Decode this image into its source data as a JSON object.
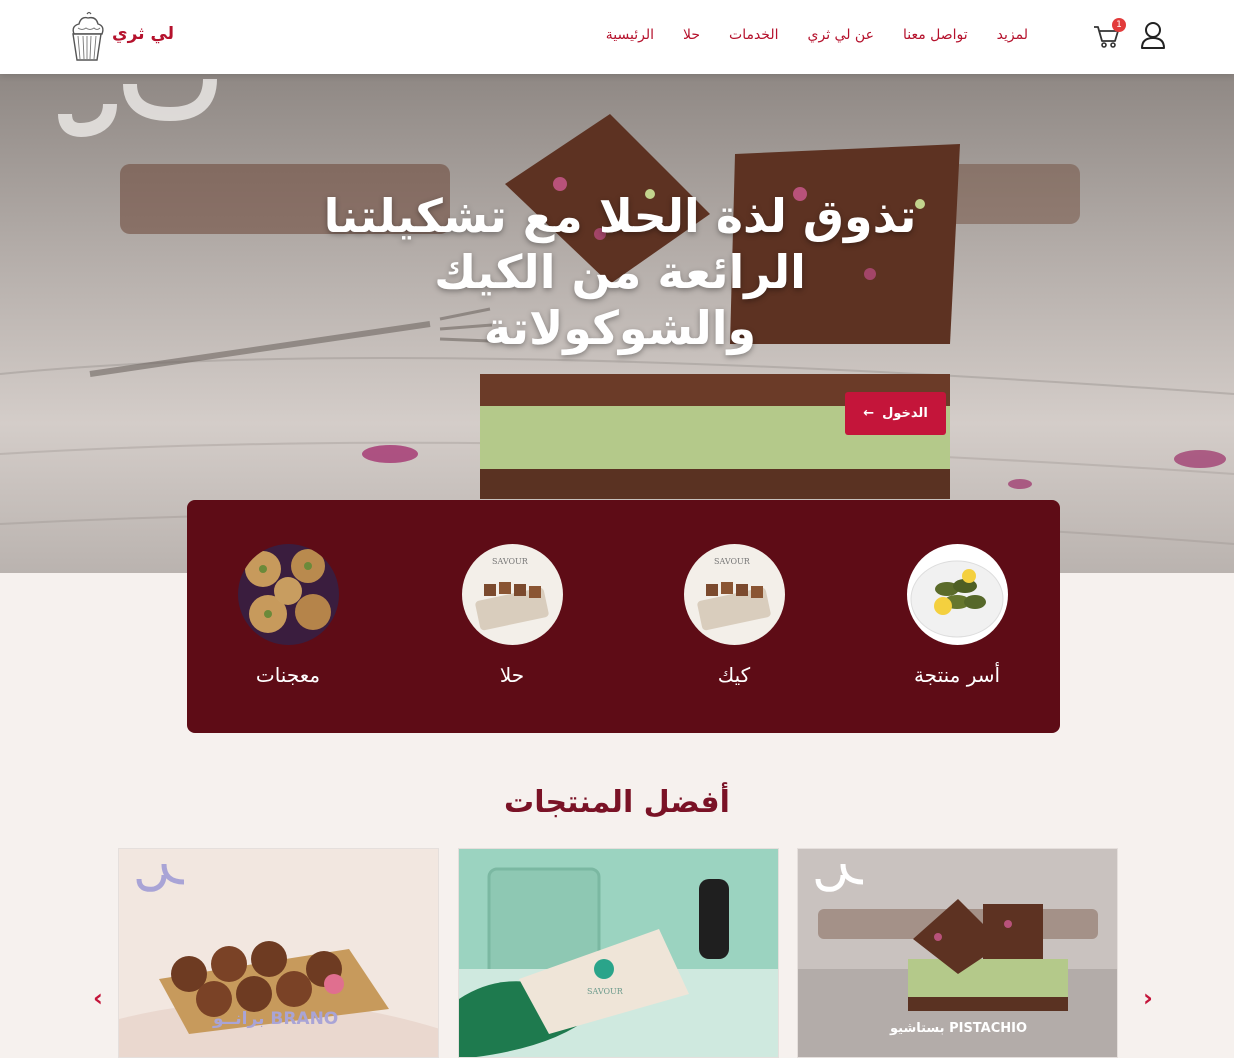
{
  "brand": {
    "name": "لي ثري",
    "logo_icon": "cupcake-icon"
  },
  "nav": {
    "links": [
      "لمزيد",
      "تواصل معنا",
      "عن لي ثري",
      "الخدمات",
      "حلا",
      "الرئيسية"
    ],
    "cart_count": "1",
    "cart_icon": "cart-icon",
    "user_icon": "user-icon"
  },
  "hero": {
    "title": "تذوق لذة الحلا مع تشكيلتنا الرائعة من الكيك والشوكولاتة",
    "button_label": "الدخول"
  },
  "categories": [
    {
      "label": "أسر منتجة",
      "image": "stuffed-grape-leaves"
    },
    {
      "label": "كيك",
      "image": "savour-sweets-box"
    },
    {
      "label": "حلا",
      "image": "savour-sweets-box"
    },
    {
      "label": "معجنات",
      "image": "cookies"
    }
  ],
  "products_section": {
    "title": "أفضل المنتجات",
    "items": [
      {
        "caption": "بستاشيو PISTACHIO",
        "image": "pistachio-chocolate-bars"
      },
      {
        "caption": "",
        "image": "savour-gift-box"
      },
      {
        "caption": "برانــو BRANO",
        "image": "chocolate-truffles"
      }
    ]
  },
  "colors": {
    "primary": "#c4153a",
    "panel": "#5e0c16",
    "title": "#7a1226",
    "background": "#f6f1ee"
  }
}
